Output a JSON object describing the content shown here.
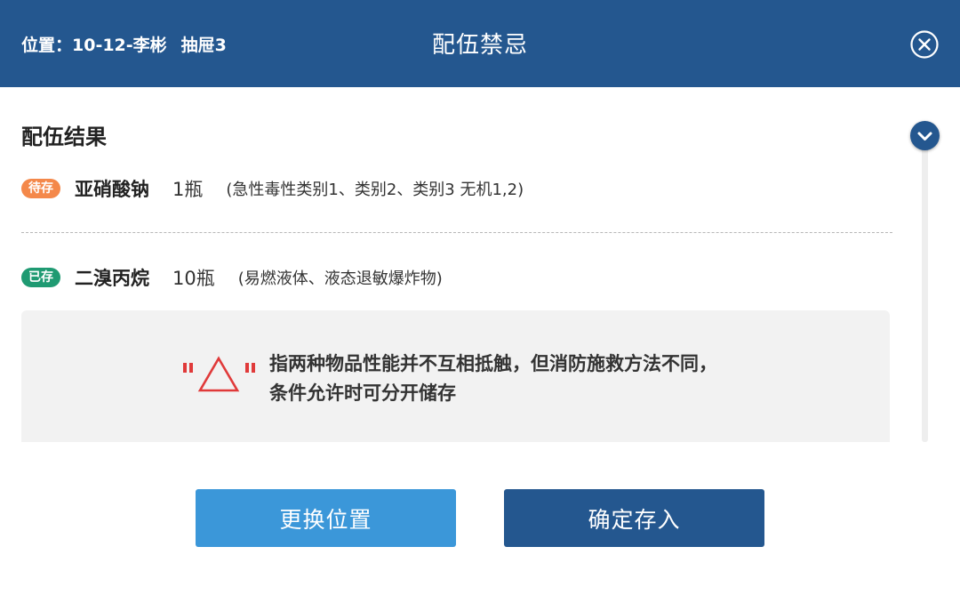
{
  "header": {
    "location_label": "位置：10-12-李彬",
    "drawer_label": "抽屉3",
    "title": "配伍禁忌",
    "close_icon": "close-circle-icon"
  },
  "section": {
    "title": "配伍结果"
  },
  "items": [
    {
      "status": "待存",
      "status_color": "#f4884a",
      "name": "亚硝酸钠",
      "quantity": "1瓶",
      "description": "(急性毒性类别1、类别2、类别3 无机1,2)"
    },
    {
      "status": "已存",
      "status_color": "#1f9a72",
      "name": "二溴丙烷",
      "quantity": "10瓶",
      "description": "(易燃液体、液态退敏爆炸物)"
    }
  ],
  "note": {
    "symbol": "\"△\"",
    "symbol_color": "#e03a3a",
    "line1": "指两种物品性能并不互相抵触，但消防施救方法不同，",
    "line2": "条件允许时可分开储存"
  },
  "scroll": {
    "icon": "chevron-down-icon"
  },
  "buttons": {
    "change_label": "更换位置",
    "confirm_label": "确定存入"
  },
  "colors": {
    "header_bg": "#24578f",
    "primary_button": "#24578f",
    "secondary_button": "#3b97d9"
  }
}
